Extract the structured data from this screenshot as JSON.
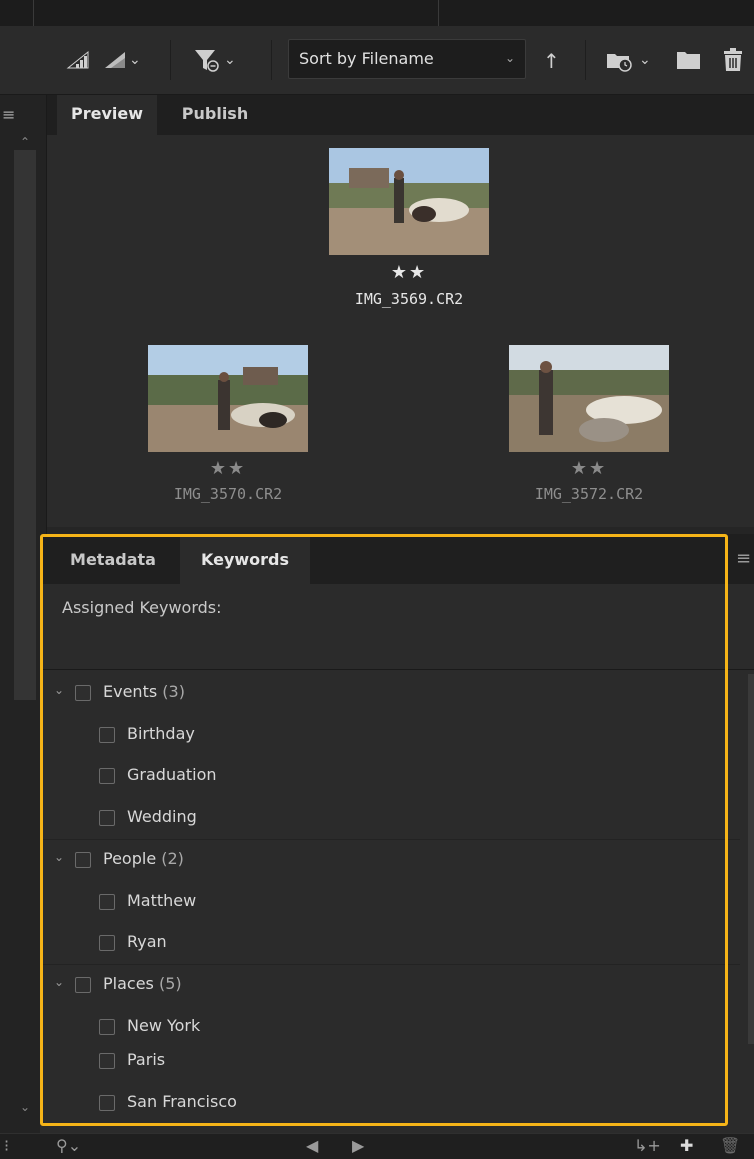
{
  "toolbar": {
    "sort_label": "Sort by Filename",
    "icons": [
      "thumbnail-quality-icon",
      "quality-dropdown-icon",
      "filter-icon",
      "sort-direction-icon",
      "recent-folder-icon",
      "new-folder-icon",
      "trash-icon"
    ]
  },
  "preview_tabs": [
    {
      "label": "Preview",
      "active": true
    },
    {
      "label": "Publish",
      "active": false
    }
  ],
  "thumbnails": [
    {
      "filename": "IMG_3569.CR2",
      "stars": "★★",
      "rating": 2,
      "selected": true
    },
    {
      "filename": "IMG_3570.CR2",
      "stars": "★★",
      "rating": 2,
      "selected": false
    },
    {
      "filename": "IMG_3572.CR2",
      "stars": "★★",
      "rating": 2,
      "selected": false
    }
  ],
  "panel_tabs": [
    {
      "label": "Metadata",
      "active": false
    },
    {
      "label": "Keywords",
      "active": true
    }
  ],
  "keywords": {
    "assigned_label": "Assigned Keywords:",
    "groups": [
      {
        "name": "Events",
        "count": "(3)",
        "children": [
          "Birthday",
          "Graduation",
          "Wedding"
        ]
      },
      {
        "name": "People",
        "count": "(2)",
        "children": [
          "Matthew",
          "Ryan"
        ]
      },
      {
        "name": "Places",
        "count": "(5)",
        "children": [
          "New York",
          "Paris",
          "San Francisco"
        ]
      }
    ]
  },
  "colors": {
    "highlight": "#f5b418",
    "panel_bg": "#2b2b2b",
    "tab_bar_bg": "#1f1f1f"
  }
}
